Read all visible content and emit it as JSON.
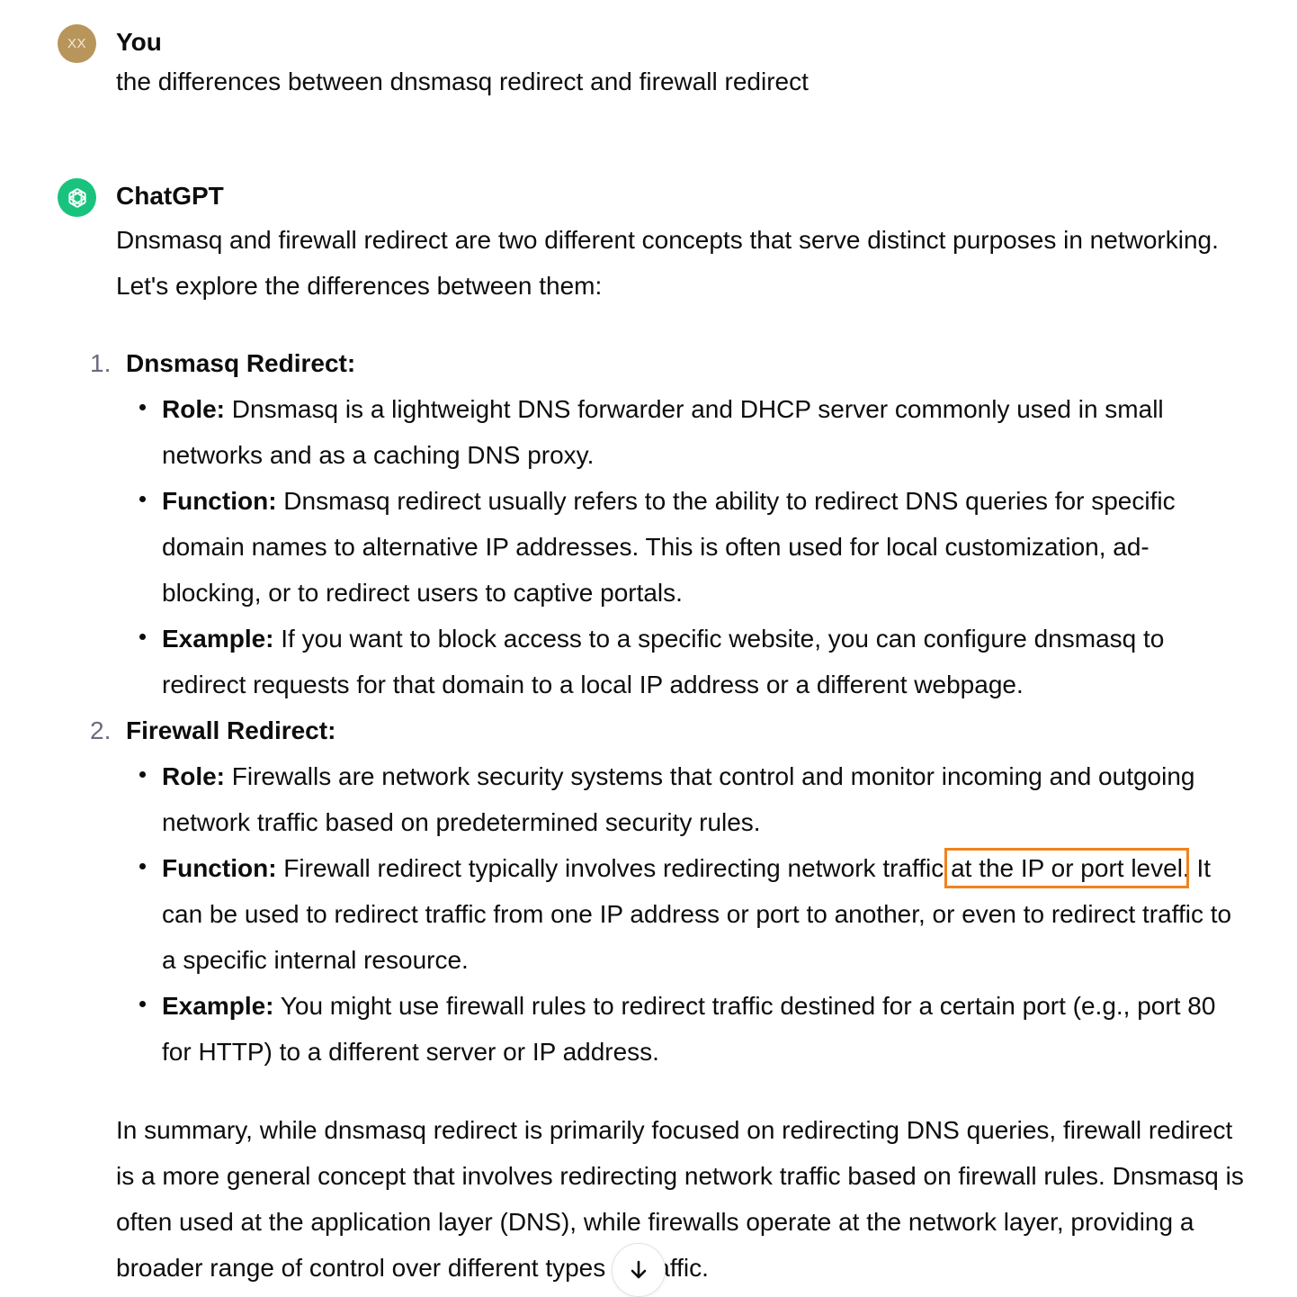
{
  "user_message": {
    "avatar_initials": "XX",
    "author": "You",
    "text": "the differences between dnsmasq redirect and firewall redirect"
  },
  "assistant_message": {
    "author": "ChatGPT",
    "intro": "Dnsmasq and firewall redirect are two different concepts that serve distinct purposes in networking. Let's explore the differences between them:",
    "sections": [
      {
        "number": "1.",
        "title": "Dnsmasq Redirect:",
        "items": [
          {
            "label": "Role:",
            "text": " Dnsmasq is a lightweight DNS forwarder and DHCP server commonly used in small networks and as a caching DNS proxy."
          },
          {
            "label": "Function:",
            "text": " Dnsmasq redirect usually refers to the ability to redirect DNS queries for specific domain names to alternative IP addresses. This is often used for local customization, ad-blocking, or to redirect users to captive portals."
          },
          {
            "label": "Example:",
            "text": " If you want to block access to a specific website, you can configure dnsmasq to redirect requests for that domain to a local IP address or a different webpage."
          }
        ]
      },
      {
        "number": "2.",
        "title": "Firewall Redirect:",
        "items": [
          {
            "label": "Role:",
            "text": " Firewalls are network security systems that control and monitor incoming and outgoing network traffic based on predetermined security rules."
          },
          {
            "label": "Function:",
            "text_before": " Firewall redirect typically involves redirecting network traffic ",
            "highlight": "at the IP or port level",
            "text_after": ". It can be used to redirect traffic from one IP address or port to another, or even to redirect traffic to a specific internal resource."
          },
          {
            "label": "Example:",
            "text": " You might use firewall rules to redirect traffic destined for a certain port (e.g., port 80 for HTTP) to a different server or IP address."
          }
        ]
      }
    ],
    "summary": "In summary, while dnsmasq redirect is primarily focused on redirecting DNS queries, firewall redirect is a more general concept that involves redirecting network traffic based on firewall rules. Dnsmasq is often used at the application layer (DNS), while firewalls operate at the network layer, providing a broader range of control over different types of traffic."
  },
  "icons": {
    "assistant_avatar": "openai-logo-icon",
    "scroll_down": "arrow-down-icon"
  },
  "colors": {
    "highlight_box": "#f0821e",
    "assistant_avatar_bg": "#19c37d",
    "user_avatar_bg": "#b8955a"
  }
}
